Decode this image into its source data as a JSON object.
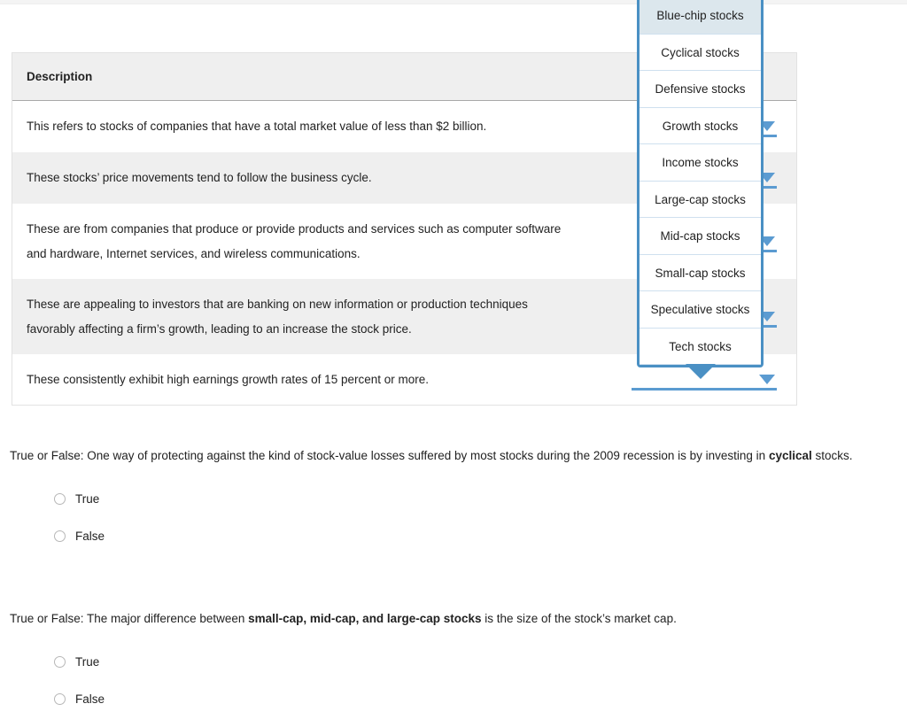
{
  "colors": {
    "accent_blue": "#5b9bd1",
    "dropdown_border": "#4a90c4",
    "selected_item_bg": "#dce7ed",
    "row_stripe": "#efefef",
    "header_bg": "#efefef",
    "text": "#222222"
  },
  "table": {
    "header": {
      "description_label": "Description"
    },
    "rows": [
      {
        "lines": [
          "This refers to stocks of companies that have a total market value of less than $2 billion."
        ],
        "control": "dropdown-select"
      },
      {
        "lines": [
          "These stocks’ price movements tend to follow the business cycle."
        ],
        "control": "dropdown-select"
      },
      {
        "lines": [
          "These are from companies that produce or provide products and services such as computer software",
          "and hardware, Internet services, and wireless communications."
        ],
        "control": "dropdown-select"
      },
      {
        "lines": [
          "These are appealing to investors that are banking on new information or production techniques",
          "favorably affecting a firm’s growth, leading to an increase the stock price."
        ],
        "control": "dropdown-select"
      },
      {
        "lines": [
          "These consistently exhibit high earnings growth rates of 15 percent or more."
        ],
        "control": "dropdown-select"
      }
    ]
  },
  "dropdown": {
    "state": "open",
    "selected_index": 0,
    "options": [
      "Blue-chip stocks",
      "Cyclical stocks",
      "Defensive stocks",
      "Growth stocks",
      "Income stocks",
      "Large-cap stocks",
      "Mid-cap stocks",
      "Small-cap stocks",
      "Speculative stocks",
      "Tech stocks"
    ]
  },
  "questions": [
    {
      "prompt_prefix": "True or False: One way of protecting against the kind of stock-value losses suffered by most stocks during the 2009 recession is by investing in ",
      "prompt_bold": "cyclical",
      "prompt_suffix": " stocks.",
      "options": [
        "True",
        "False"
      ],
      "selected": null
    },
    {
      "prompt_prefix": "True or False: The major difference between ",
      "prompt_bold": "small-cap, mid-cap, and large-cap stocks",
      "prompt_suffix": " is the size of the stock’s market cap.",
      "options": [
        "True",
        "False"
      ],
      "selected": null
    }
  ]
}
